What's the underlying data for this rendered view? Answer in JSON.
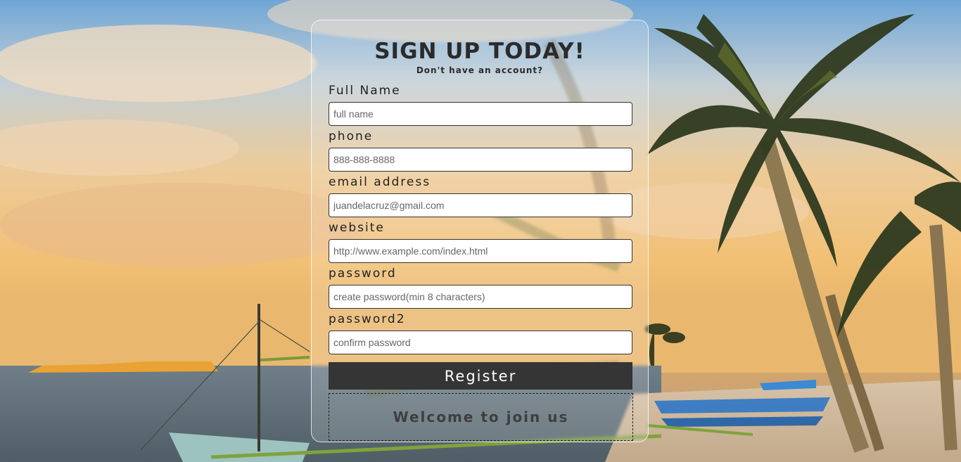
{
  "form": {
    "title": "SIGN UP TODAY!",
    "subtitle": "Don't have an account?",
    "fields": [
      {
        "label": "Full Name",
        "placeholder": "full name"
      },
      {
        "label": "phone",
        "placeholder": "888-888-8888"
      },
      {
        "label": "email address",
        "placeholder": "juandelacruz@gmail.com"
      },
      {
        "label": "website",
        "placeholder": "http://www.example.com/index.html"
      },
      {
        "label": "password",
        "placeholder": "create password(min 8 characters)"
      },
      {
        "label": "password2",
        "placeholder": "confirm password"
      }
    ],
    "register_label": "Register",
    "welcome_text": "Welcome to join us"
  },
  "colors": {
    "button_bg": "#353535",
    "text": "#2b2b2b"
  }
}
